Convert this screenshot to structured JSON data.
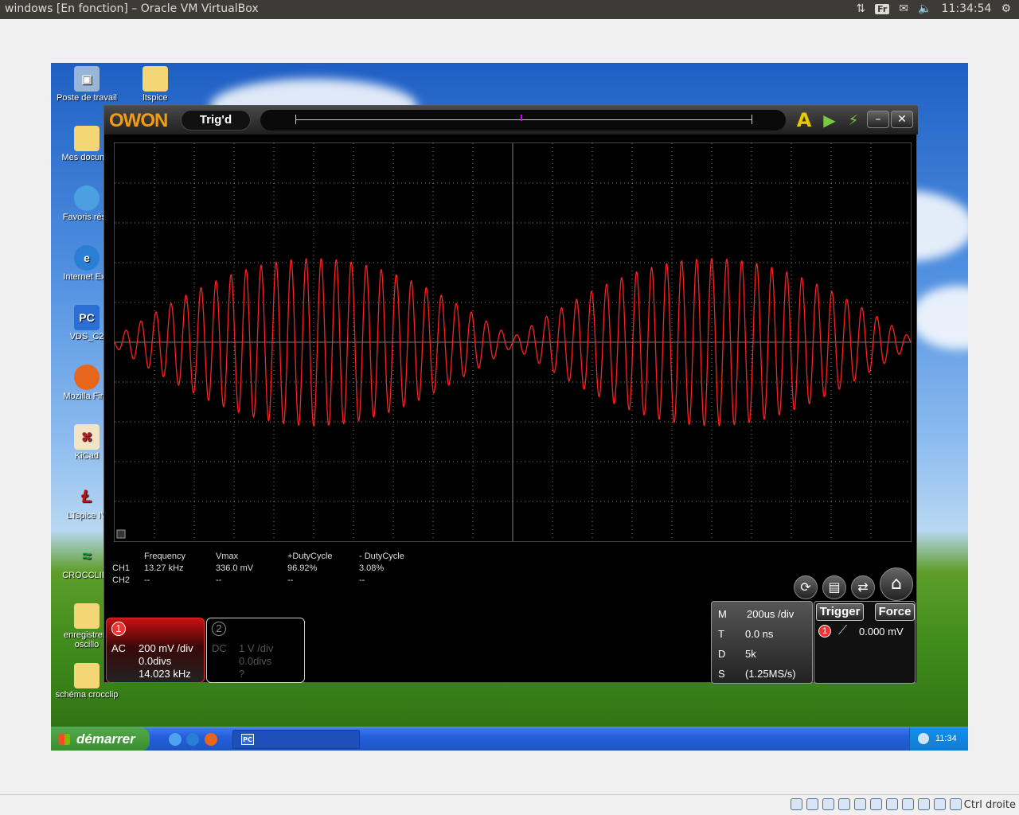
{
  "host": {
    "window_title": "windows [En fonction] – Oracle VM VirtualBox",
    "keyboard": "Fr",
    "clock": "11:34:54",
    "host_key": "Ctrl droite"
  },
  "desktop": {
    "icons": [
      {
        "label": "Poste de travail",
        "icon": "computer-icon"
      },
      {
        "label": "ltspice",
        "icon": "folder-icon"
      },
      {
        "label": "Mes docume",
        "icon": "documents-folder-icon"
      },
      {
        "label": "Favoris rése",
        "icon": "network-icon"
      },
      {
        "label": "Internet Exp",
        "icon": "internet-explorer-icon"
      },
      {
        "label": "VDS_C2",
        "icon": "pc-app-icon"
      },
      {
        "label": "Mozilla Firef",
        "icon": "firefox-icon"
      },
      {
        "label": "KiCad",
        "icon": "kicad-icon"
      },
      {
        "label": "LTspice IV",
        "icon": "ltspice-icon"
      },
      {
        "label": "CROCCLIP.I",
        "icon": "crocodile-clips-icon"
      },
      {
        "label": "enregistrem oscillo",
        "icon": "folder-icon"
      },
      {
        "label": "schéma crocclip",
        "icon": "folder-icon"
      }
    ]
  },
  "scope": {
    "brand": "OWON",
    "status": "Trig'd",
    "measurements": {
      "headers": [
        "Frequency",
        "Vmax",
        "+DutyCycle",
        "- DutyCycle"
      ],
      "rows": [
        {
          "ch": "CH1",
          "values": [
            "13.27 kHz",
            "336.0 mV",
            "96.92%",
            "3.08%"
          ]
        },
        {
          "ch": "CH2",
          "values": [
            "--",
            "--",
            "--",
            "--"
          ]
        }
      ]
    },
    "ch1": {
      "num": "1",
      "coupling": "AC",
      "scale": "200 mV /div",
      "offset": "0.0divs",
      "freq": "14.023 kHz"
    },
    "ch2": {
      "num": "2",
      "coupling": "DC",
      "scale": "1 V /div",
      "offset": "0.0divs",
      "freq": "?"
    },
    "timebase": {
      "m_label": "M",
      "m": "200us /div",
      "t_label": "T",
      "t": "0.0 ns",
      "d_label": "D",
      "d": "5k",
      "s_label": "S",
      "s": "(1.25MS/s)"
    },
    "trigger": {
      "label": "Trigger",
      "force": "Force",
      "source": "1",
      "level": "0.000 mV"
    },
    "colors": {
      "ch1": "#ff2020",
      "ch2": "#ffff00",
      "grid": "#808080",
      "trigger_bar": "#f39c12"
    }
  },
  "chart_data": {
    "type": "line",
    "title": "",
    "xlabel": "",
    "ylabel": "",
    "xlim": [
      -1.0,
      1.0
    ],
    "ylim": [
      -0.8,
      0.8
    ],
    "x_unit": "ms",
    "y_unit": "V",
    "grid": true,
    "series": [
      {
        "name": "CH1",
        "carrier_khz": 26.5,
        "envelope_khz": 2.0,
        "amplitude_v": 0.336
      }
    ]
  },
  "taskbar": {
    "start": "démarrer",
    "tray_time": "11:34"
  }
}
